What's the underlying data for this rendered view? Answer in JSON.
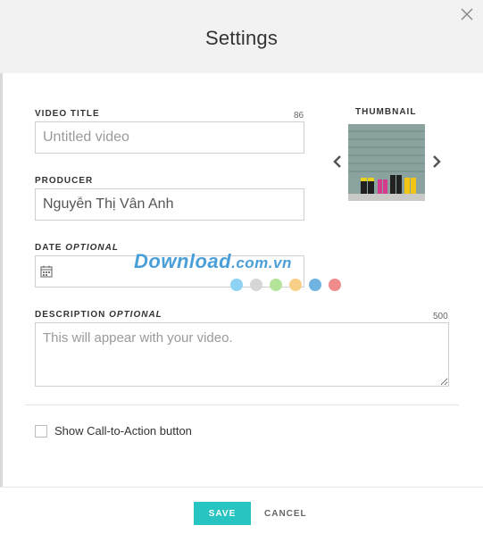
{
  "dialog": {
    "title": "Settings"
  },
  "form": {
    "video_title": {
      "label": "VIDEO TITLE",
      "counter": "86",
      "placeholder": "Untitled video"
    },
    "producer": {
      "label": "PRODUCER",
      "value": "Nguyễn Thị Vân Anh"
    },
    "date": {
      "label": "DATE",
      "optional": "OPTIONAL",
      "value": ""
    },
    "description": {
      "label": "DESCRIPTION",
      "optional": "OPTIONAL",
      "counter": "500",
      "placeholder": "This will appear with your video."
    },
    "cta_checkbox": {
      "label": "Show Call-to-Action button",
      "checked": false
    }
  },
  "thumbnail": {
    "label": "THUMBNAIL"
  },
  "footer": {
    "save_label": "SAVE",
    "cancel_label": "CANCEL"
  },
  "watermark": {
    "text_main": "Download",
    "text_domain": ".com.vn",
    "dot_colors": [
      "#8fd3f4",
      "#d6d6d6",
      "#b4e39a",
      "#f7cf87",
      "#6fb3e0",
      "#f08b8b"
    ]
  },
  "colors": {
    "accent": "#28c4c2",
    "header_bg": "#f2f2f2"
  }
}
